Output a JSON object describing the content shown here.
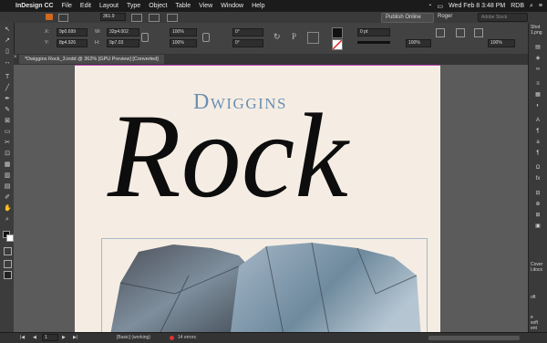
{
  "menubar": {
    "app_name": "InDesign CC",
    "items": [
      "File",
      "Edit",
      "Layout",
      "Type",
      "Object",
      "Table",
      "View",
      "Window",
      "Help"
    ],
    "publish_label": "Publish Online",
    "workspace": "Roger",
    "search_placeholder": "Adobe Stock",
    "clock": "Wed Feb 8  3:48 PM",
    "user": "RDB"
  },
  "appbar": {
    "zoom": "361.9"
  },
  "control": {
    "x_label": "X:",
    "x_value": "9p0.699",
    "y_label": "Y:",
    "y_value": "8p4.926",
    "w_label": "W:",
    "w_value": "32p4.002",
    "h_label": "H:",
    "h_value": "9p7.03",
    "scale_x": "100%",
    "scale_y": "100%",
    "rotate": "0°",
    "shear": "0°",
    "stroke_weight": "0 pt",
    "opacity": "100%",
    "zoom_pct": "100%"
  },
  "document": {
    "tab_title": "*Dwiggins Rock_3.indd @ 362% [GPU Preview] [Converted]"
  },
  "artwork": {
    "title_small": "Dwiggins",
    "title_large": "Rock"
  },
  "dock": {
    "labels": [
      "Shot",
      "1.png",
      "Cover",
      "l.docx",
      "oft",
      "e",
      "soft",
      "ent"
    ]
  },
  "status": {
    "page": "1",
    "style": "[Basic] (working)",
    "errors": "14 errors"
  },
  "colors": {
    "title_blue": "#6b8fb3",
    "page_bg": "#f5ede3",
    "ink": "#0d0d0d"
  }
}
